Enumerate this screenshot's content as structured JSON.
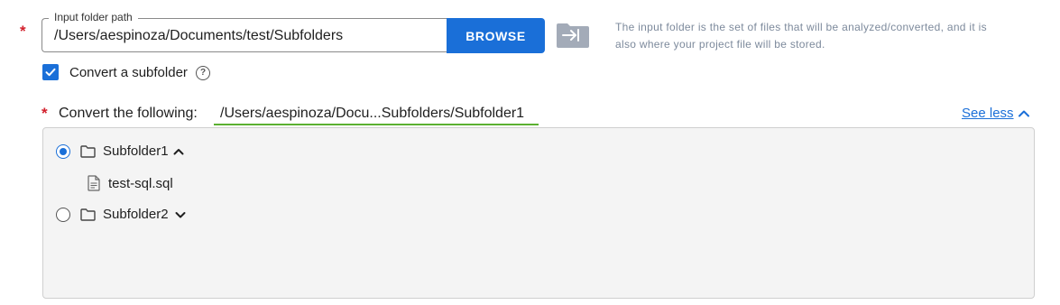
{
  "input_folder": {
    "required_marker": "*",
    "label": "Input folder path",
    "value": "/Users/aespinoza/Documents/test/Subfolders",
    "browse_label": "BROWSE",
    "help_line1": "The input folder is the set of files that will be analyzed/converted, and it is",
    "help_line2": "also where your project file will be stored."
  },
  "convert_subfolder": {
    "checked": true,
    "label": "Convert a subfolder",
    "help_glyph": "?"
  },
  "convert_following": {
    "required_marker": "*",
    "label": "Convert the following:",
    "path": "/Users/aespinoza/Docu...Subfolders/Subfolder1",
    "toggle_label": "See less"
  },
  "tree": {
    "items": [
      {
        "label": "Subfolder1",
        "selected": true,
        "expanded": true
      },
      {
        "label": "test-sql.sql",
        "type": "file"
      },
      {
        "label": "Subfolder2",
        "selected": false,
        "expanded": false
      }
    ]
  },
  "colors": {
    "accent": "#1a6fd8",
    "required": "#d21f2b",
    "highlight": "#5bb031",
    "help_text": "#7d8a9c"
  }
}
